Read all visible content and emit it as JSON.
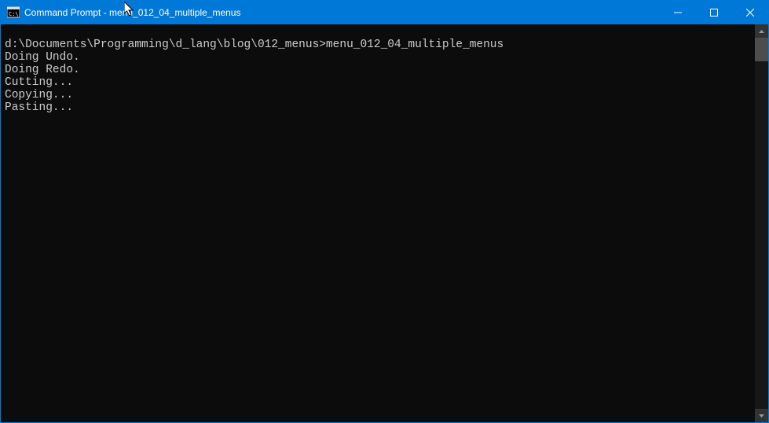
{
  "titlebar": {
    "title": "Command Prompt - menu_012_04_multiple_menus"
  },
  "terminal": {
    "prompt_path": "d:\\Documents\\Programming\\d_lang\\blog\\012_menus>",
    "command": "menu_012_04_multiple_menus",
    "output_lines": [
      "Doing Undo.",
      "Doing Redo.",
      "Cutting...",
      "Copying...",
      "Pasting..."
    ]
  }
}
